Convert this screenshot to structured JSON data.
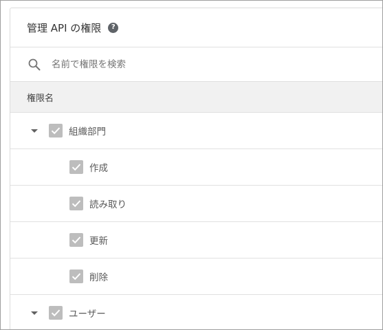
{
  "header": {
    "title": "管理 API の権限",
    "help_icon": "help-circle-icon"
  },
  "search": {
    "placeholder": "名前で権限を検索",
    "value": "",
    "icon": "search-icon"
  },
  "table": {
    "column_header": "権限名"
  },
  "rows": [
    {
      "label": "組織部門",
      "checked": true,
      "expanded": true,
      "level": 0
    },
    {
      "label": "作成",
      "checked": true,
      "level": 1
    },
    {
      "label": "読み取り",
      "checked": true,
      "level": 1
    },
    {
      "label": "更新",
      "checked": true,
      "level": 1
    },
    {
      "label": "削除",
      "checked": true,
      "level": 1
    },
    {
      "label": "ユーザー",
      "checked": true,
      "expanded": true,
      "level": 0
    }
  ],
  "colors": {
    "checkbox_disabled": "#bdbdbd",
    "header_bg": "#f1f1f1",
    "divider": "#e0e0e0",
    "help_icon_bg": "#5f6368"
  }
}
